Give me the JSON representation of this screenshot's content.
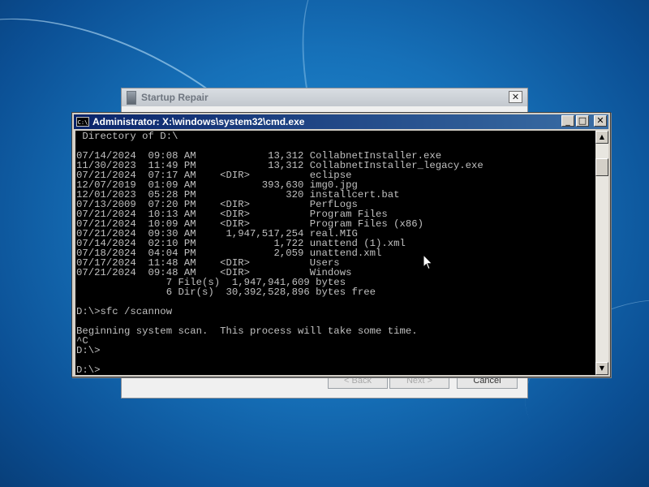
{
  "startup_repair": {
    "title": "Startup Repair",
    "close_glyph": "✕",
    "back_label": "< Back",
    "next_label": "Next >",
    "cancel_label": "Cancel"
  },
  "cmd": {
    "title": "Administrator: X:\\windows\\system32\\cmd.exe",
    "icon_text": "C:\\",
    "minimize_glyph": "_",
    "maximize_glyph": "□",
    "close_glyph": "✕",
    "scroll_up_glyph": "▲",
    "scroll_down_glyph": "▼",
    "lines": [
      " Directory of D:\\",
      "",
      "07/14/2024  09:08 AM            13,312 CollabnetInstaller.exe",
      "11/30/2023  11:49 PM            13,312 CollabnetInstaller_legacy.exe",
      "07/21/2024  07:17 AM    <DIR>          eclipse",
      "12/07/2019  01:09 AM           393,630 img0.jpg",
      "12/01/2023  05:28 PM               320 installcert.bat",
      "07/13/2009  07:20 PM    <DIR>          PerfLogs",
      "07/21/2024  10:13 AM    <DIR>          Program Files",
      "07/21/2024  10:09 AM    <DIR>          Program Files (x86)",
      "07/21/2024  09:30 AM     1,947,517,254 real.MIG",
      "07/14/2024  02:10 PM             1,722 unattend (1).xml",
      "07/18/2024  04:04 PM             2,059 unattend.xml",
      "07/17/2024  11:48 AM    <DIR>          Users",
      "07/21/2024  09:48 AM    <DIR>          Windows",
      "               7 File(s)  1,947,941,609 bytes",
      "               6 Dir(s)  30,392,528,896 bytes free",
      "",
      "D:\\>sfc /scannow",
      "",
      "Beginning system scan.  This process will take some time.",
      "^C",
      "D:\\>",
      "",
      "D:\\>"
    ]
  }
}
